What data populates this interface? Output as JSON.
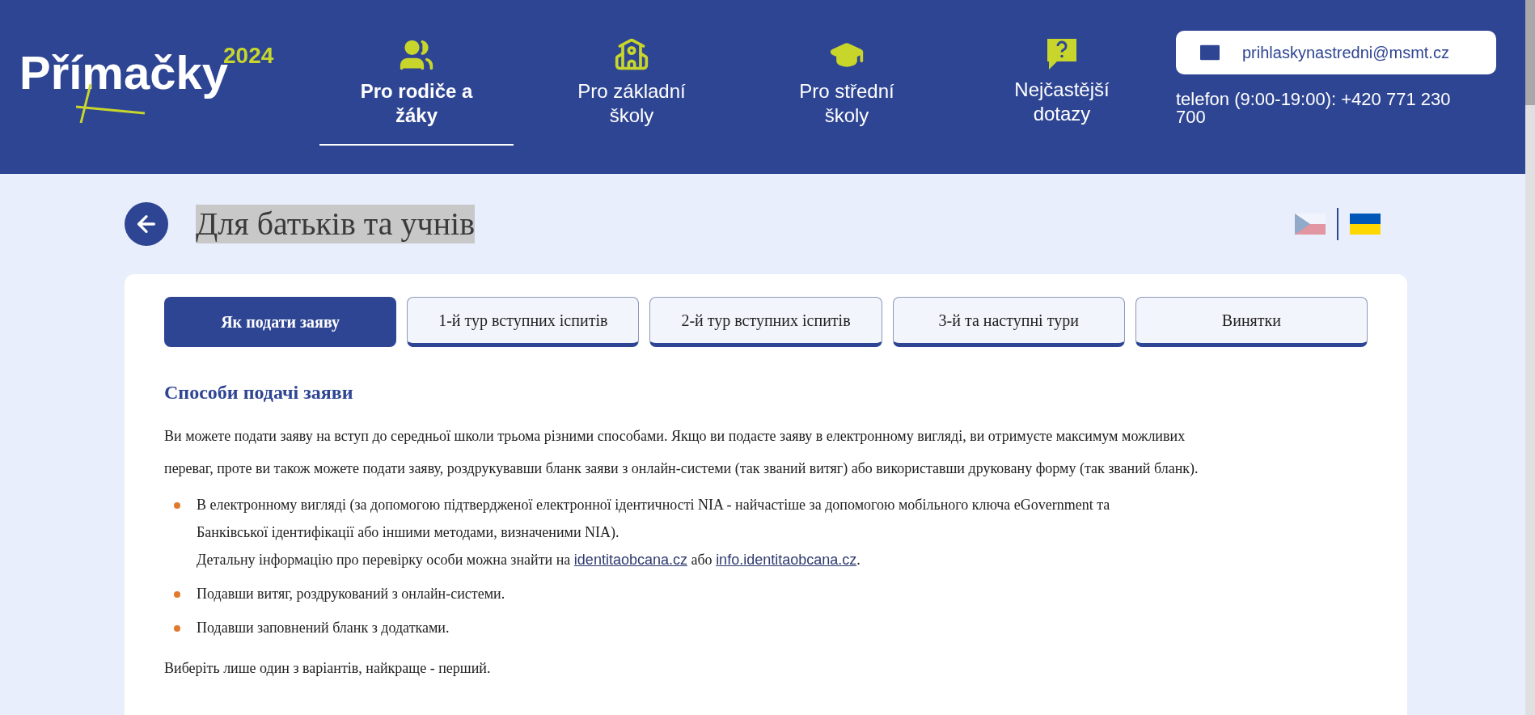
{
  "header": {
    "logo": {
      "name": "Přímačky",
      "year": "2024"
    },
    "nav": [
      {
        "label": "Pro rodiče a žáky",
        "selected": true
      },
      {
        "label": "Pro základní školy",
        "selected": false
      },
      {
        "label": "Pro střední školy",
        "selected": false
      },
      {
        "label": "Nejčastější dotazy",
        "selected": false
      }
    ],
    "email": "prihlaskynastredni@msmt.cz",
    "phone": "telefon (9:00-19:00): +420 771 230 700"
  },
  "page": {
    "title": "Для батьків та учнів",
    "title_highlighted": true,
    "languages": [
      {
        "selected": false
      },
      {
        "selected": true
      }
    ]
  },
  "tabs": [
    {
      "label": "Як подати заяву",
      "selected": true
    },
    {
      "label": "1-й тур вступних іспитів",
      "selected": false
    },
    {
      "label": "2-й тур вступних іспитів",
      "selected": false
    },
    {
      "label": "3-й та наступні тури",
      "selected": false
    },
    {
      "label": "Винятки",
      "selected": false
    }
  ],
  "content": {
    "heading": "Способи подачі заяви",
    "intro": "Ви можете подати заяву на вступ до середньої школи трьома різними способами. Якщо ви подаєте заяву в електронному вигляді, ви отримуєте максимум можливих переваг, проте ви також можете подати заяву, роздрукувавши бланк заяви з онлайн-системи (так званий витяг) або використавши друковану форму (так званий бланк).",
    "items": [
      {
        "text": "В електронному вигляді (за допомогою підтвердженої електронної ідентичності NIA - найчастіше за допомогою мобільного ключа eGovernment та Банківської ідентифікації або іншими методами, визначеними NIA).",
        "detail": [
          {
            "kind": "text",
            "text": "Детальну інформацію про перевірку особи можна знайти на "
          },
          {
            "kind": "link",
            "text": "identitaobcana.cz"
          },
          {
            "kind": "text",
            "text": " або "
          },
          {
            "kind": "link",
            "text": "info.identitaobcana.cz"
          },
          {
            "kind": "text",
            "text": "."
          }
        ]
      },
      {
        "text": "Подавши витяг, роздрукований з онлайн-системи."
      },
      {
        "text": "Подавши заповнений бланк з додатками."
      }
    ],
    "note": "Виберіть лише один з варіантів, найкраще - перший."
  }
}
